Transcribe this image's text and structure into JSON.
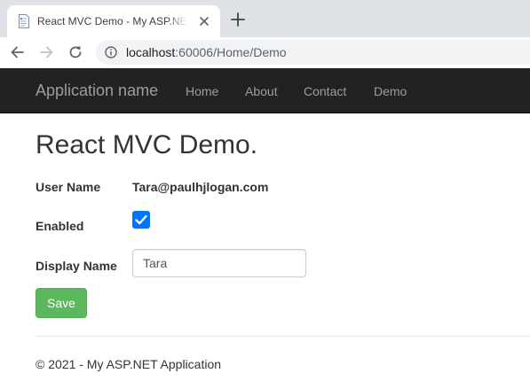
{
  "browser": {
    "tab_title": "React MVC Demo - My ASP.NET Application",
    "url_host": "localhost",
    "url_rest": ":60006/Home/Demo"
  },
  "navbar": {
    "brand": "Application name",
    "links": [
      "Home",
      "About",
      "Contact",
      "Demo"
    ]
  },
  "main": {
    "title": "React MVC Demo.",
    "user_name_label": "User Name",
    "user_name_value": "Tara@paulhjlogan.com",
    "enabled_label": "Enabled",
    "enabled": true,
    "display_name_label": "Display Name",
    "display_name_value": "Tara",
    "save_label": "Save"
  },
  "footer": {
    "text": "© 2021 - My ASP.NET Application"
  },
  "colors": {
    "navbar_bg": "#222222",
    "nav_text": "#9d9d9d",
    "save_button": "#5cb85c",
    "checkbox": "#0075ff"
  }
}
